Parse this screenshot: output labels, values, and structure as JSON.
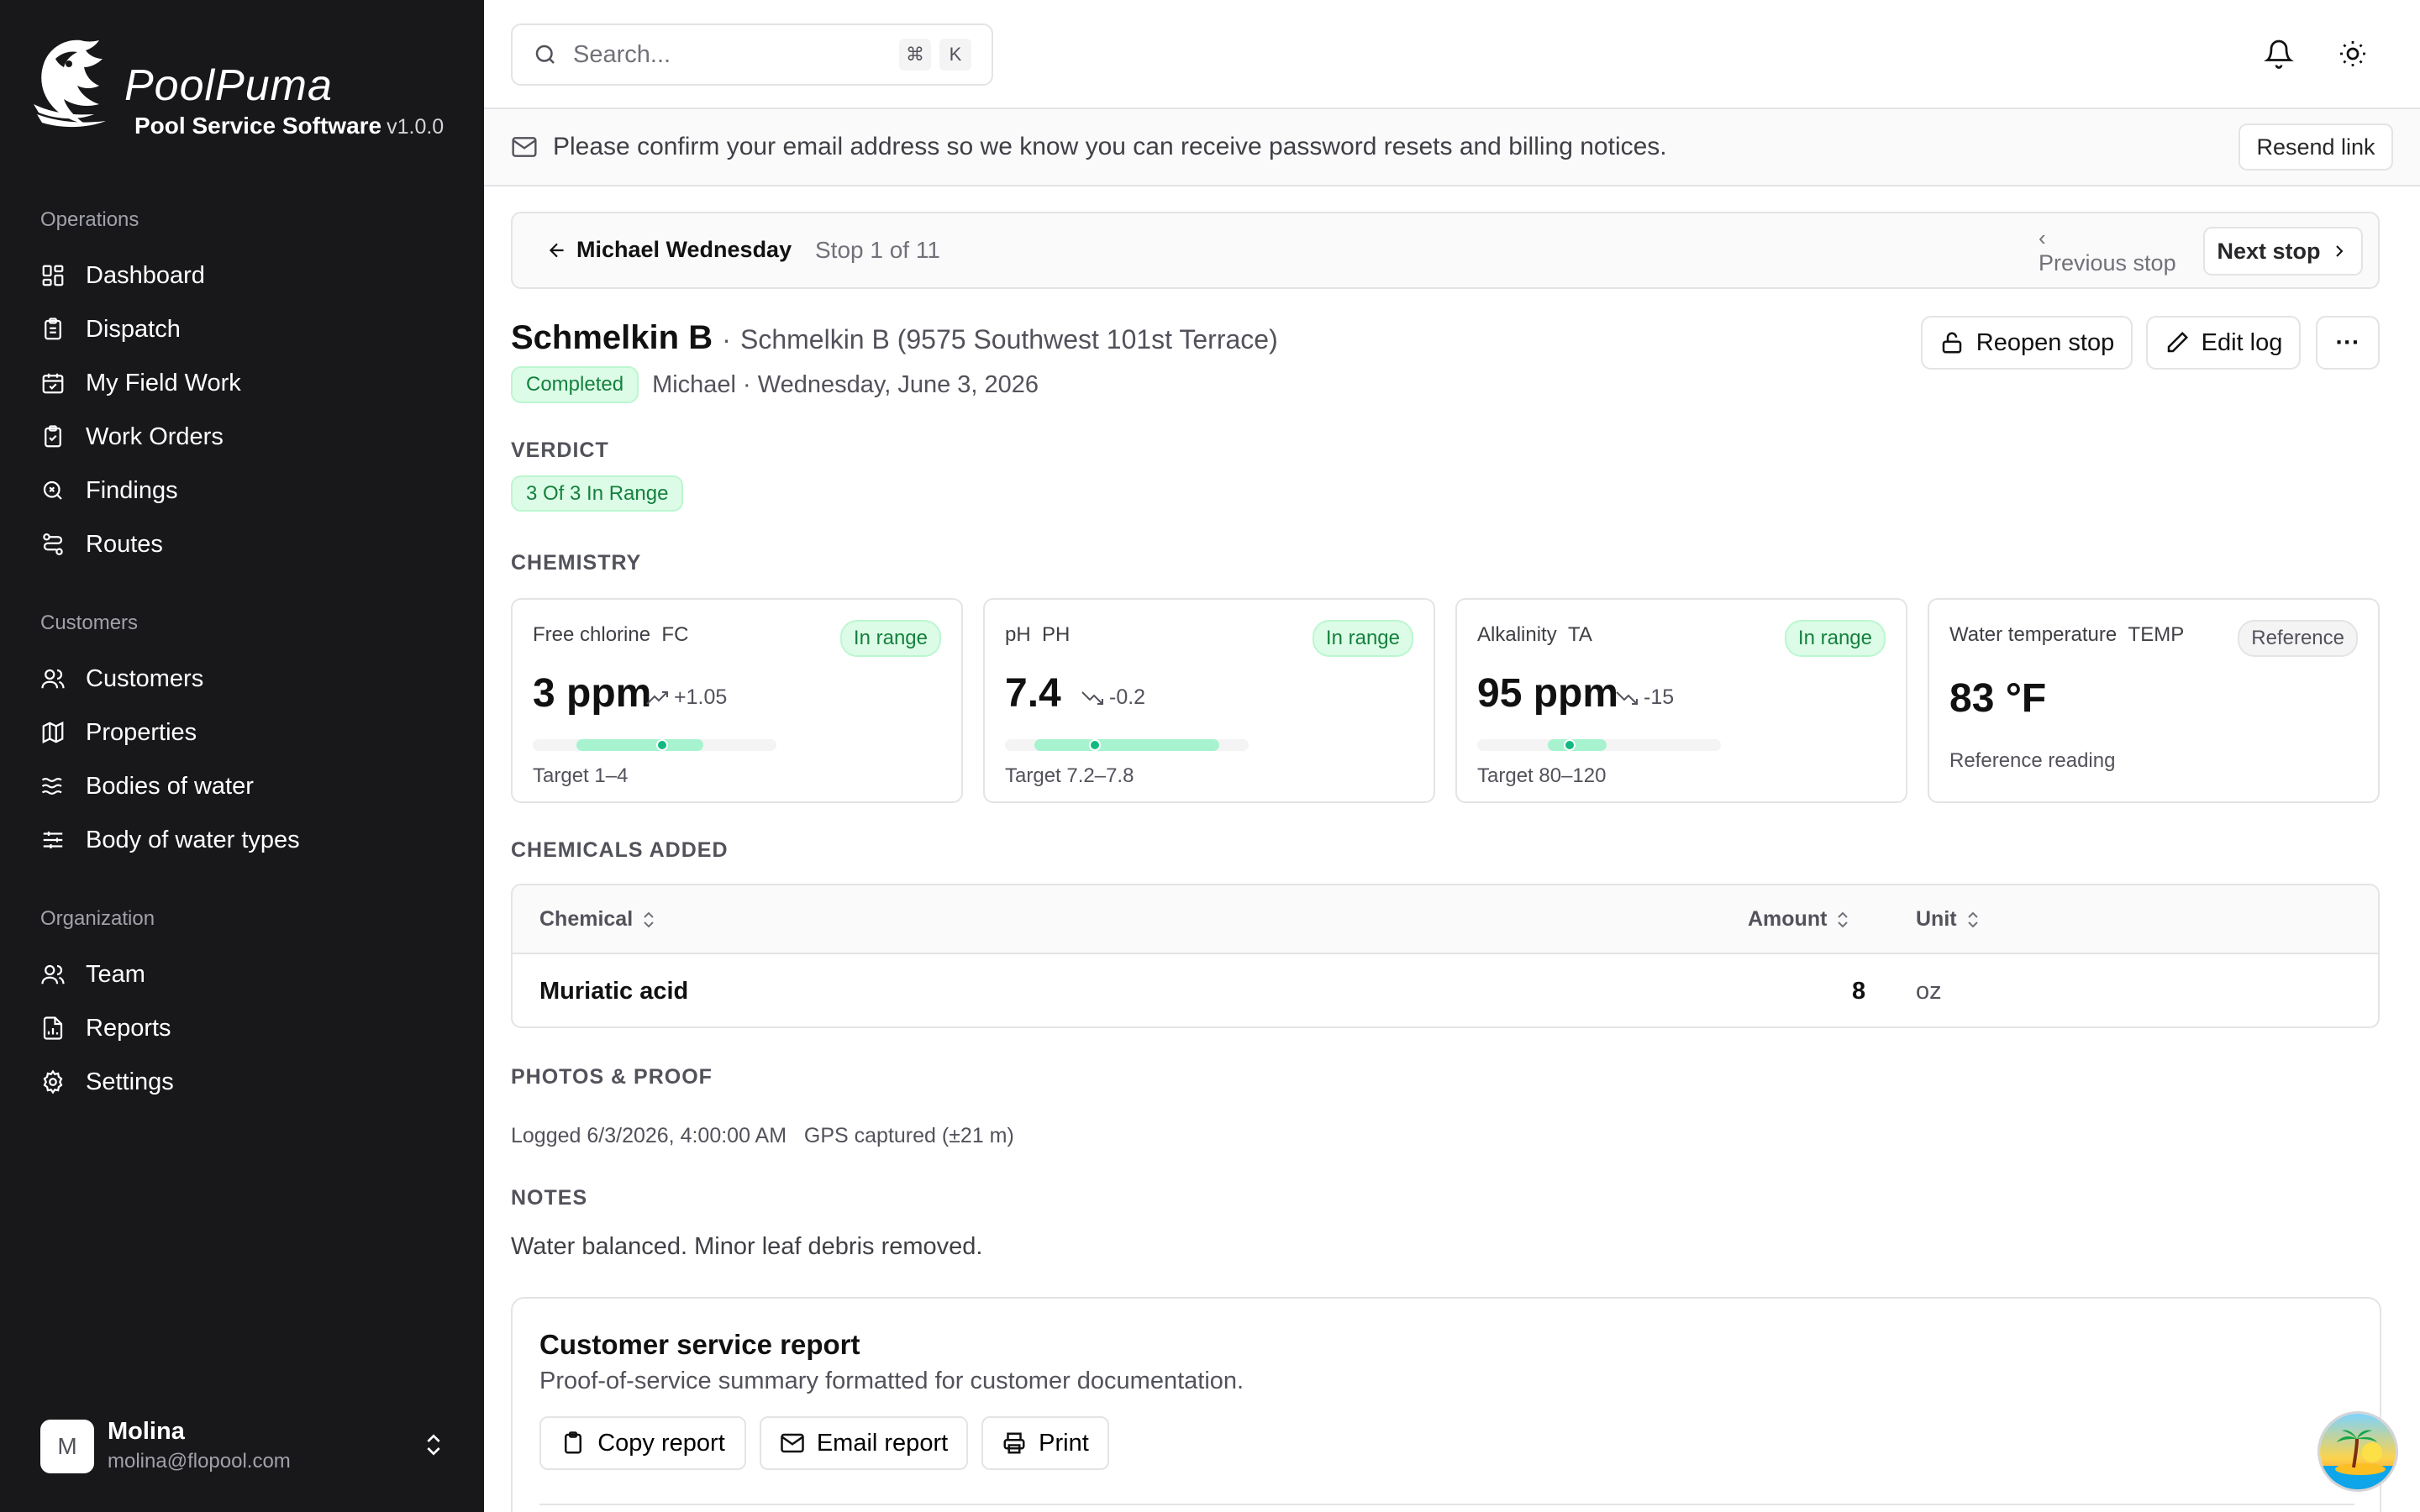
{
  "brand": {
    "name": "PoolPuma",
    "subtitle": "Pool Service Software",
    "version": "v1.0.0"
  },
  "sidebar": {
    "sections": [
      {
        "title": "Operations",
        "items": [
          {
            "label": "Dashboard",
            "icon": "dashboard-icon"
          },
          {
            "label": "Dispatch",
            "icon": "clipboard-icon"
          },
          {
            "label": "My Field Work",
            "icon": "calendar-check-icon"
          },
          {
            "label": "Work Orders",
            "icon": "clipboard-check-icon"
          },
          {
            "label": "Findings",
            "icon": "search-x-icon"
          },
          {
            "label": "Routes",
            "icon": "route-icon"
          }
        ]
      },
      {
        "title": "Customers",
        "items": [
          {
            "label": "Customers",
            "icon": "users-icon"
          },
          {
            "label": "Properties",
            "icon": "map-icon"
          },
          {
            "label": "Bodies of water",
            "icon": "waves-icon"
          },
          {
            "label": "Body of water types",
            "icon": "sliders-icon"
          }
        ]
      },
      {
        "title": "Organization",
        "items": [
          {
            "label": "Team",
            "icon": "users-icon"
          },
          {
            "label": "Reports",
            "icon": "file-chart-icon"
          },
          {
            "label": "Settings",
            "icon": "gear-icon"
          }
        ]
      }
    ],
    "user": {
      "initial": "M",
      "name": "Molina",
      "email": "molina@flopool.com"
    }
  },
  "topbar": {
    "search_placeholder": "Search...",
    "shortcut_keys": [
      "⌘",
      "K"
    ]
  },
  "banner": {
    "message": "Please confirm your email address so we know you can receive password resets and billing notices.",
    "action": "Resend link"
  },
  "stop_nav": {
    "back_label": "Michael Wednesday",
    "stop_count": "Stop 1 of 11",
    "prev_label": "Previous stop",
    "next_label": "Next stop"
  },
  "stop": {
    "title": "Schmelkin B",
    "subtitle": "Schmelkin B (9575 Southwest 101st Terrace)",
    "status": "Completed",
    "meta": "Michael · Wednesday, June 3, 2026",
    "actions": {
      "reopen": "Reopen stop",
      "edit": "Edit log",
      "more": "···"
    }
  },
  "verdict": {
    "heading": "VERDICT",
    "value": "3 Of 3 In Range"
  },
  "chemistry": {
    "heading": "CHEMISTRY",
    "cards": [
      {
        "label": "Free chlorine",
        "code": "FC",
        "badge": "In range",
        "value": "3 ppm",
        "delta": "+1.05",
        "trend": "up",
        "target": "Target 1–4",
        "range_start": 0.18,
        "range_end": 0.7,
        "level": 0.53
      },
      {
        "label": "pH",
        "code": "PH",
        "badge": "In range",
        "value": "7.4",
        "delta": "-0.2",
        "trend": "down",
        "target": "Target 7.2–7.8",
        "range_start": 0.12,
        "range_end": 0.88,
        "level": 0.37
      },
      {
        "label": "Alkalinity",
        "code": "TA",
        "badge": "In range",
        "value": "95 ppm",
        "delta": "-15",
        "trend": "down",
        "target": "Target 80–120",
        "range_start": 0.29,
        "range_end": 0.53,
        "level": 0.38
      },
      {
        "label": "Water temperature",
        "code": "TEMP",
        "badge": "Reference",
        "value": "83 °F",
        "note": "Reference reading"
      }
    ]
  },
  "chemicals": {
    "heading": "CHEMICALS ADDED",
    "columns": [
      "Chemical",
      "Amount",
      "Unit"
    ],
    "rows": [
      {
        "chemical": "Muriatic acid",
        "amount": "8",
        "unit": "oz"
      }
    ]
  },
  "proof": {
    "heading": "PHOTOS & PROOF",
    "logged": "Logged 6/3/2026, 4:00:00 AM",
    "gps": "GPS captured (±21 m)"
  },
  "notes": {
    "heading": "NOTES",
    "text": "Water balanced. Minor leaf debris removed."
  },
  "report": {
    "title": "Customer service report",
    "description": "Proof-of-service summary formatted for customer documentation.",
    "buttons": {
      "copy": "Copy report",
      "email": "Email report",
      "print": "Print"
    }
  },
  "colors": {
    "sidebar_bg": "#18181b",
    "success": "#15803d",
    "success_bg": "#dcfce7",
    "range_fill": "#a7f3d0",
    "marker": "#10b981"
  }
}
